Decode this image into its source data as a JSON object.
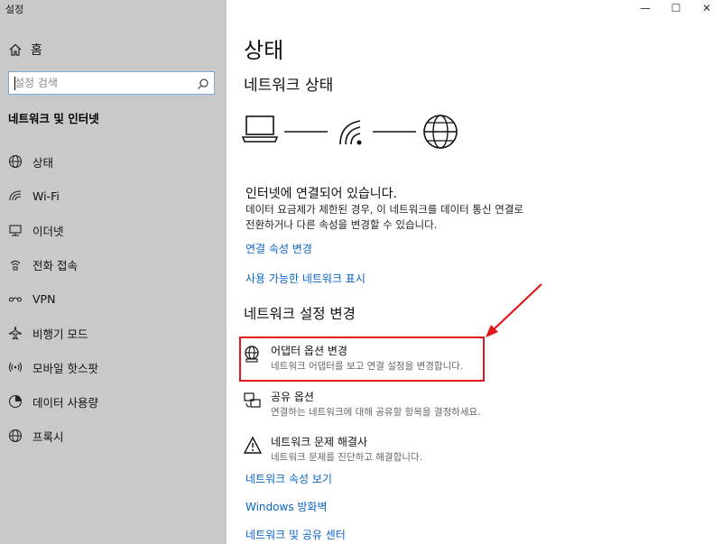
{
  "window": {
    "title": "설정",
    "controls": {
      "minimize": "—",
      "maximize": "☐",
      "close": "✕"
    }
  },
  "sidebar": {
    "home_label": "홈",
    "search_placeholder": "설정 검색",
    "section_title": "네트워크 및 인터넷",
    "items": [
      {
        "label": "상태",
        "icon": "globe-status-icon"
      },
      {
        "label": "Wi-Fi",
        "icon": "wifi-icon"
      },
      {
        "label": "이더넷",
        "icon": "ethernet-icon"
      },
      {
        "label": "전화 접속",
        "icon": "dialup-icon"
      },
      {
        "label": "VPN",
        "icon": "vpn-icon"
      },
      {
        "label": "비행기 모드",
        "icon": "airplane-icon"
      },
      {
        "label": "모바일 핫스팟",
        "icon": "hotspot-icon"
      },
      {
        "label": "데이터 사용량",
        "icon": "data-usage-icon"
      },
      {
        "label": "프록시",
        "icon": "globe-icon"
      }
    ]
  },
  "main": {
    "title": "상태",
    "network_status_title": "네트워크 상태",
    "connected_text": "인터넷에 연결되어 있습니다.",
    "description_line1": "데이터 요금제가 제한된 경우, 이 네트워크를 데이터 통신 연결로",
    "description_line2": "전환하거나 다른 속성을 변경할 수 있습니다.",
    "link_change_props": "연결 속성 변경",
    "link_show_networks": "사용 가능한 네트워크 표시",
    "change_settings_title": "네트워크 설정 변경",
    "options": [
      {
        "title": "어댑터 옵션 변경",
        "desc": "네트워크 어댑터를 보고 연결 설정을 변경합니다.",
        "icon": "adapter-globe-icon"
      },
      {
        "title": "공유 옵션",
        "desc": "연결하는 네트워크에 대해 공유할 항목을 결정하세요.",
        "icon": "sharing-icon"
      },
      {
        "title": "네트워크 문제 해결사",
        "desc": "네트워크 문제를 진단하고 해결합니다.",
        "icon": "warning-icon"
      }
    ],
    "link_network_props": "네트워크 속성 보기",
    "link_firewall": "Windows 방화벽",
    "link_sharing_center": "네트워크 및 공유 센터"
  },
  "colors": {
    "accent_link": "#0a64c6",
    "highlight": "#e0161b",
    "sidebar_bg": "#c9c9c9"
  }
}
